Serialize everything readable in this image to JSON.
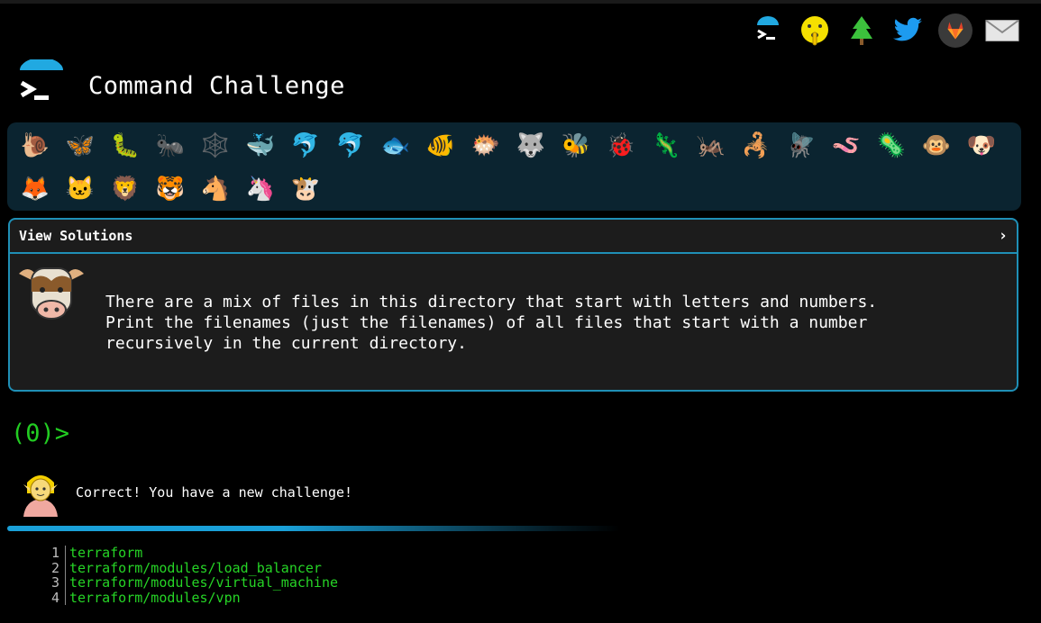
{
  "header": {
    "title": "Command Challenge"
  },
  "top_icons": [
    "terminal-logo-icon",
    "shushing-face-icon",
    "evergreen-tree-icon",
    "twitter-icon",
    "gitlab-icon",
    "mail-icon"
  ],
  "animals": {
    "row1": [
      "🐌",
      "🦋",
      "🐛",
      "🐜",
      "🕸️",
      "🐳",
      "🐬",
      "🐬",
      "🐟",
      "🐠",
      "🐡",
      "🐺",
      "🐝",
      "🐞",
      "🦎",
      "🦗",
      "🦂",
      "🪰",
      "🪱",
      "🦠",
      "🐵",
      "🐶"
    ],
    "row2": [
      "🦊",
      "🐱",
      "🦁",
      "🐯",
      "🐴",
      "🦄",
      "🐮"
    ]
  },
  "challenge": {
    "toggle_label": "View Solutions",
    "chevron": "›",
    "text": "There are a mix of files in this directory that start with letters and numbers.\nPrint the filenames (just the filenames) of all files that start with a number\nrecursively in the current directory."
  },
  "prompt": {
    "text": "(0)>"
  },
  "result": {
    "message": "Correct! You have a new challenge!"
  },
  "output": [
    {
      "num": "1",
      "value": "terraform"
    },
    {
      "num": "2",
      "value": "terraform/modules/load_balancer"
    },
    {
      "num": "3",
      "value": "terraform/modules/virtual_machine"
    },
    {
      "num": "4",
      "value": "terraform/modules/vpn"
    }
  ],
  "colors": {
    "accent": "#1f8fb6",
    "prompt_green": "#22cc22",
    "panel": "#0b2430"
  }
}
